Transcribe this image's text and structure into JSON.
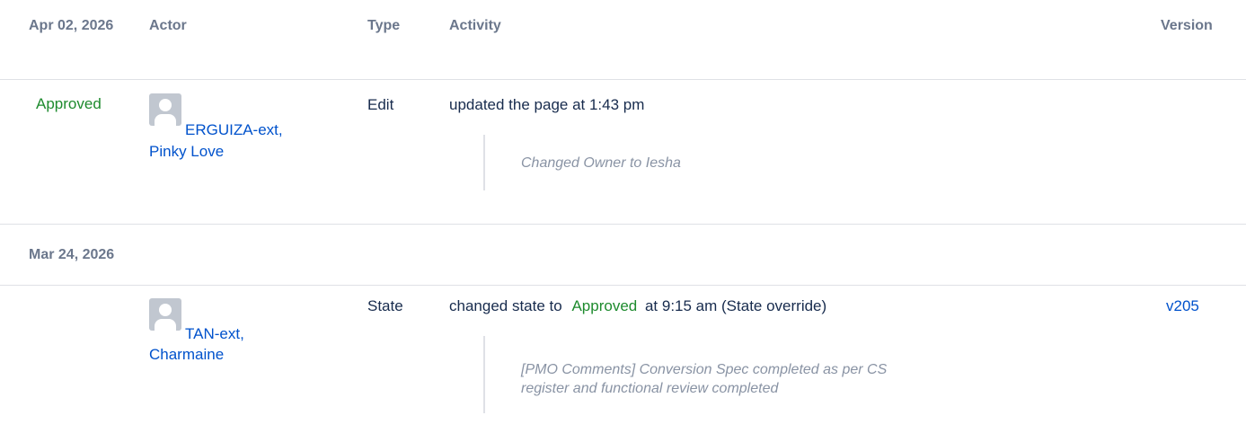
{
  "table": {
    "columns": {
      "date": "Apr 02, 2026",
      "actor": "Actor",
      "type": "Type",
      "activity": "Activity",
      "version": "Version"
    }
  },
  "groups": [
    {
      "entries": [
        {
          "state": "Approved",
          "actor": {
            "line1": "ERGUIZA-ext,",
            "line2": "Pinky Love",
            "avatar_icon": "user-avatar-icon"
          },
          "type": "Edit",
          "activity": "updated the page at 1:43 pm",
          "comment": "Changed Owner to Iesha",
          "version": ""
        }
      ]
    },
    {
      "date": "Mar 24, 2026",
      "entries": [
        {
          "actor": {
            "line1": "TAN-ext,",
            "line2": "Charmaine",
            "avatar_icon": "user-avatar-icon"
          },
          "type": "State",
          "activity_prefix": "changed state to",
          "activity_state": "Approved",
          "activity_suffix": "at 9:15 am (State override)",
          "comment_line1": "[PMO Comments] Conversion Spec completed as per CS",
          "comment_line2": "register and functional review completed",
          "version": "v205"
        }
      ]
    }
  ],
  "colors": {
    "approved": "#1e8b2e",
    "link": "#0052cc",
    "header": "#6b778c",
    "comment": "#8993a4",
    "divider": "#dfe1e6"
  }
}
